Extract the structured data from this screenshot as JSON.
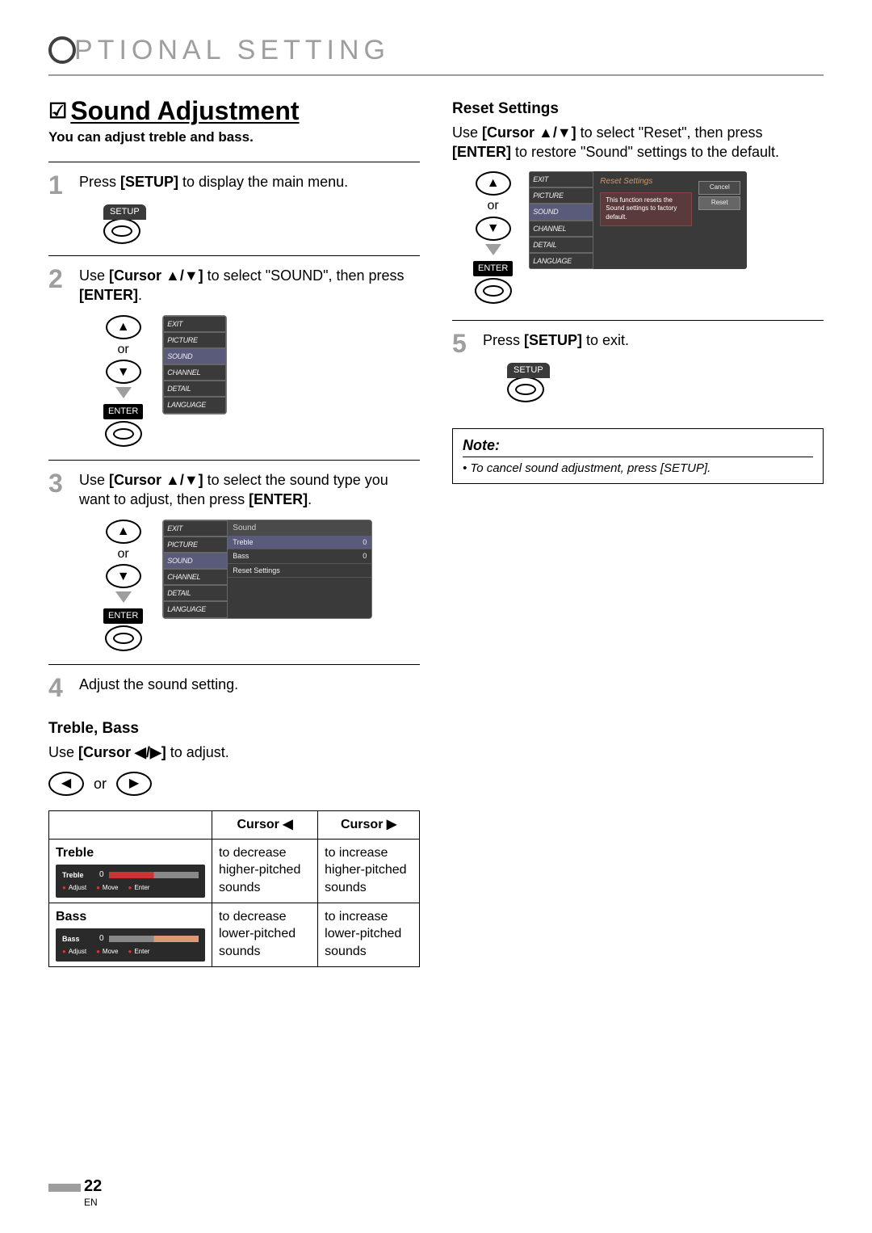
{
  "section_header": "PTIONAL   SETTING",
  "title": "Sound Adjustment",
  "subtitle": "You can adjust treble and bass.",
  "steps": {
    "s1": {
      "num": "1",
      "text_pre": "Press ",
      "setup": "[SETUP]",
      "text_post": " to display the main menu."
    },
    "s2": {
      "num": "2",
      "text_a": "Use ",
      "cursor": "[Cursor ▲/▼]",
      "text_b": " to select \"SOUND\", then press ",
      "enter": "[ENTER]",
      "period": "."
    },
    "s3": {
      "num": "3",
      "text_a": "Use ",
      "cursor": "[Cursor ▲/▼]",
      "text_b": " to select the sound type you want to adjust, then press ",
      "enter": "[ENTER]",
      "period": "."
    },
    "s4": {
      "num": "4",
      "text": "Adjust the sound setting."
    },
    "s5": {
      "num": "5",
      "text_a": "Press ",
      "setup": "[SETUP]",
      "text_b": " to exit."
    }
  },
  "remote": {
    "or": "or",
    "enter": "ENTER",
    "setup": "SETUP"
  },
  "osd_menu_items": [
    "EXIT",
    "PICTURE",
    "SOUND",
    "CHANNEL",
    "DETAIL",
    "LANGUAGE"
  ],
  "osd_sound_panel": {
    "header": "Sound",
    "rows": [
      {
        "label": "Treble",
        "val": "0"
      },
      {
        "label": "Bass",
        "val": "0"
      },
      {
        "label": "Reset Settings",
        "val": ""
      }
    ]
  },
  "treble_bass": {
    "heading": "Treble, Bass",
    "text_a": "Use ",
    "cursor": "[Cursor ◀/▶]",
    "text_b": " to adjust."
  },
  "cursor_table": {
    "h_blank": "",
    "h_left": "Cursor ◀",
    "h_right": "Cursor ▶",
    "rows": [
      {
        "name": "Treble",
        "left": "to decrease higher-pitched sounds",
        "right": "to increase higher-pitched sounds",
        "slider": {
          "label": "Treble",
          "value": "0",
          "footer": [
            "Adjust",
            "Move",
            "Enter"
          ]
        }
      },
      {
        "name": "Bass",
        "left": "to decrease lower-pitched sounds",
        "right": "to increase lower-pitched sounds",
        "slider": {
          "label": "Bass",
          "value": "0",
          "footer": [
            "Adjust",
            "Move",
            "Enter"
          ]
        }
      }
    ]
  },
  "reset": {
    "heading": "Reset Settings",
    "text_a": "Use ",
    "cursor": "[Cursor ▲/▼]",
    "text_b": " to select \"Reset\", then press ",
    "enter": "[ENTER]",
    "text_c": " to restore \"Sound\" settings to the default.",
    "panel_header": "Reset Settings",
    "panel_msg": "This function resets the Sound settings to factory default.",
    "cancel": "Cancel",
    "reset_btn": "Reset"
  },
  "note": {
    "title": "Note:",
    "body": "To cancel sound adjustment, press [SETUP]."
  },
  "page_number": "22",
  "page_lang": "EN"
}
